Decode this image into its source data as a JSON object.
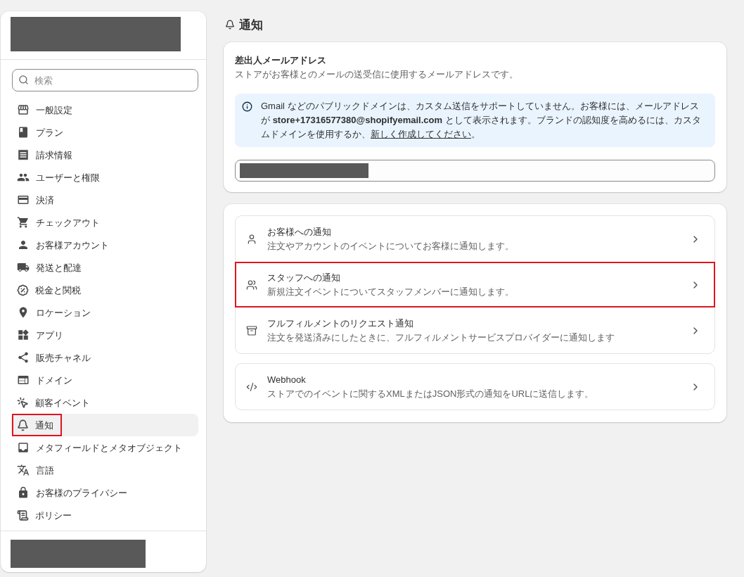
{
  "sidebar": {
    "search": {
      "placeholder": "検索"
    },
    "items": [
      {
        "label": "一般設定",
        "selected": false,
        "highlighted": false
      },
      {
        "label": "プラン",
        "selected": false,
        "highlighted": false
      },
      {
        "label": "請求情報",
        "selected": false,
        "highlighted": false
      },
      {
        "label": "ユーザーと権限",
        "selected": false,
        "highlighted": false
      },
      {
        "label": "決済",
        "selected": false,
        "highlighted": false
      },
      {
        "label": "チェックアウト",
        "selected": false,
        "highlighted": false
      },
      {
        "label": "お客様アカウント",
        "selected": false,
        "highlighted": false
      },
      {
        "label": "発送と配達",
        "selected": false,
        "highlighted": false
      },
      {
        "label": "税金と関税",
        "selected": false,
        "highlighted": false
      },
      {
        "label": "ロケーション",
        "selected": false,
        "highlighted": false
      },
      {
        "label": "アプリ",
        "selected": false,
        "highlighted": false
      },
      {
        "label": "販売チャネル",
        "selected": false,
        "highlighted": false
      },
      {
        "label": "ドメイン",
        "selected": false,
        "highlighted": false
      },
      {
        "label": "顧客イベント",
        "selected": false,
        "highlighted": false
      },
      {
        "label": "通知",
        "selected": true,
        "highlighted": true
      },
      {
        "label": "メタフィールドとメタオブジェクト",
        "selected": false,
        "highlighted": false
      },
      {
        "label": "言語",
        "selected": false,
        "highlighted": false
      },
      {
        "label": "お客様のプライバシー",
        "selected": false,
        "highlighted": false
      },
      {
        "label": "ポリシー",
        "selected": false,
        "highlighted": false
      }
    ]
  },
  "page": {
    "title": "通知"
  },
  "sender_email": {
    "title": "差出人メールアドレス",
    "description": "ストアがお客様とのメールの送受信に使用するメールアドレスです。",
    "notice": {
      "text": "Gmail などのパブリックドメインは、カスタム送信をサポートしていません。お客様には、メールアドレスが **store+17316577380@shopifyemail.com** として表示されます。ブランドの認知度を高めるには、カスタムドメインを使用するか、",
      "link": "新しく作成してください",
      "text_after": "。"
    }
  },
  "notification_groups": [
    {
      "items": [
        {
          "title": "お客様への通知",
          "description": "注文やアカウントのイベントについてお客様に通知します。",
          "highlighted": false
        },
        {
          "title": "スタッフへの通知",
          "description": "新規注文イベントについてスタッフメンバーに通知します。",
          "highlighted": true
        },
        {
          "title": "フルフィルメントのリクエスト通知",
          "description": "注文を発送済みにしたときに、フルフィルメントサービスプロバイダーに通知します",
          "highlighted": false
        }
      ]
    },
    {
      "items": [
        {
          "title": "Webhook",
          "description": "ストアでのイベントに関するXMLまたはJSON形式の通知をURLに送信します。",
          "highlighted": false
        }
      ]
    }
  ]
}
